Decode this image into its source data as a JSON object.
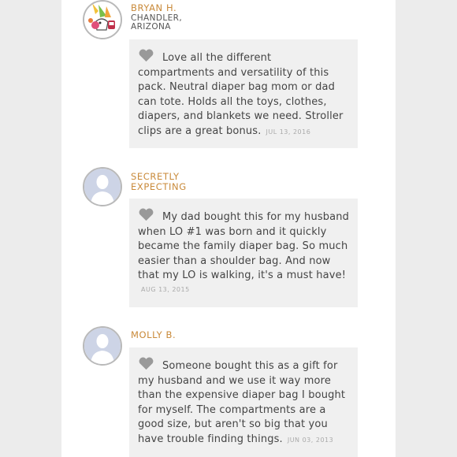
{
  "reviews": [
    {
      "name": "BRYAN H.",
      "location": "CHANDLER, ARIZONA",
      "avatar": "cartoon-avatar",
      "text": "Love all the different compartments and versatility of this pack. Neutral diaper bag mom or dad can tote. Holds all the toys, clothes, diapers, and blankets we need. Stroller clips are a great bonus.",
      "date": "JUL 13, 2016"
    },
    {
      "name": "SECRETLY EXPECTING",
      "location": "",
      "avatar": "default-person-avatar",
      "text": "My dad bought this for my husband when LO #1 was born and it quickly became the family diaper bag. So much easier than a shoulder bag. And now that my LO is walking, it's a must have!",
      "date": "AUG 13, 2015"
    },
    {
      "name": "MOLLY B.",
      "location": "",
      "avatar": "default-person-avatar",
      "text": "Someone bought this as a gift for my husband and we use it way more than the expensive diaper bag I bought for myself. The compartments are a good size, but aren't so big that you have trouble finding things.",
      "date": "JUN 03, 2013"
    }
  ],
  "icons": {
    "like": "heart-icon"
  },
  "colors": {
    "name": "#c98a3a",
    "bubble": "#f0f0f0",
    "heart": "#999999"
  }
}
